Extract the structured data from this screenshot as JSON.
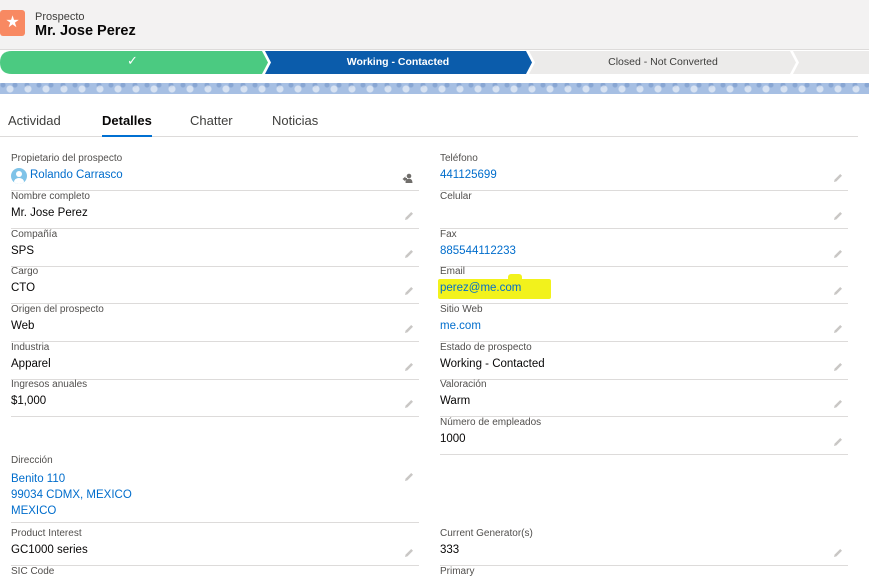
{
  "header": {
    "object_type": "Prospecto",
    "record_name": "Mr. Jose Perez",
    "icon": "star-icon",
    "icon_color": "#f88962"
  },
  "path": {
    "completed_color": "#4bca81",
    "current_color": "#0b5cab",
    "upcoming_color": "#ecebea",
    "completed_icon": "check-icon",
    "current_stage": "Working - Contacted",
    "next_stage": "Closed - Not Converted"
  },
  "tabs": [
    {
      "label": "Actividad",
      "active": false
    },
    {
      "label": "Detalles",
      "active": true
    },
    {
      "label": "Chatter",
      "active": false
    },
    {
      "label": "Noticias",
      "active": false
    }
  ],
  "fields": {
    "owner": {
      "label": "Propietario del prospecto",
      "value": "Rolando Carrasco"
    },
    "phone": {
      "label": "Teléfono",
      "value": "441125699"
    },
    "full_name": {
      "label": "Nombre completo",
      "value": "Mr. Jose Perez"
    },
    "mobile": {
      "label": "Celular",
      "value": ""
    },
    "company": {
      "label": "Compañía",
      "value": "SPS"
    },
    "fax": {
      "label": "Fax",
      "value": "885544112233"
    },
    "title": {
      "label": "Cargo",
      "value": "CTO"
    },
    "email": {
      "label": "Email",
      "value": "perez@me.com",
      "highlight_color": "#f2f21c"
    },
    "lead_source": {
      "label": "Origen del prospecto",
      "value": "Web"
    },
    "website": {
      "label": "Sitio Web",
      "value": "me.com"
    },
    "industry": {
      "label": "Industria",
      "value": "Apparel"
    },
    "lead_status": {
      "label": "Estado de prospecto",
      "value": "Working - Contacted"
    },
    "annual_revenue": {
      "label": "Ingresos anuales",
      "value": "$1,000"
    },
    "rating": {
      "label": "Valoración",
      "value": "Warm"
    },
    "employees": {
      "label": "Número de empleados",
      "value": "1000"
    },
    "address": {
      "label": "Dirección",
      "line1": "Benito 110",
      "line2": "99034 CDMX, MEXICO",
      "line3": "MEXICO"
    },
    "product_interest": {
      "label": "Product Interest",
      "value": "GC1000 series"
    },
    "current_generators": {
      "label": "Current Generator(s)",
      "value": "333"
    },
    "sic_code": {
      "label": "SIC Code",
      "value": ""
    },
    "primary": {
      "label": "Primary",
      "value": ""
    }
  },
  "link_color": "#006dcc",
  "tab_active_color": "#0070d2"
}
